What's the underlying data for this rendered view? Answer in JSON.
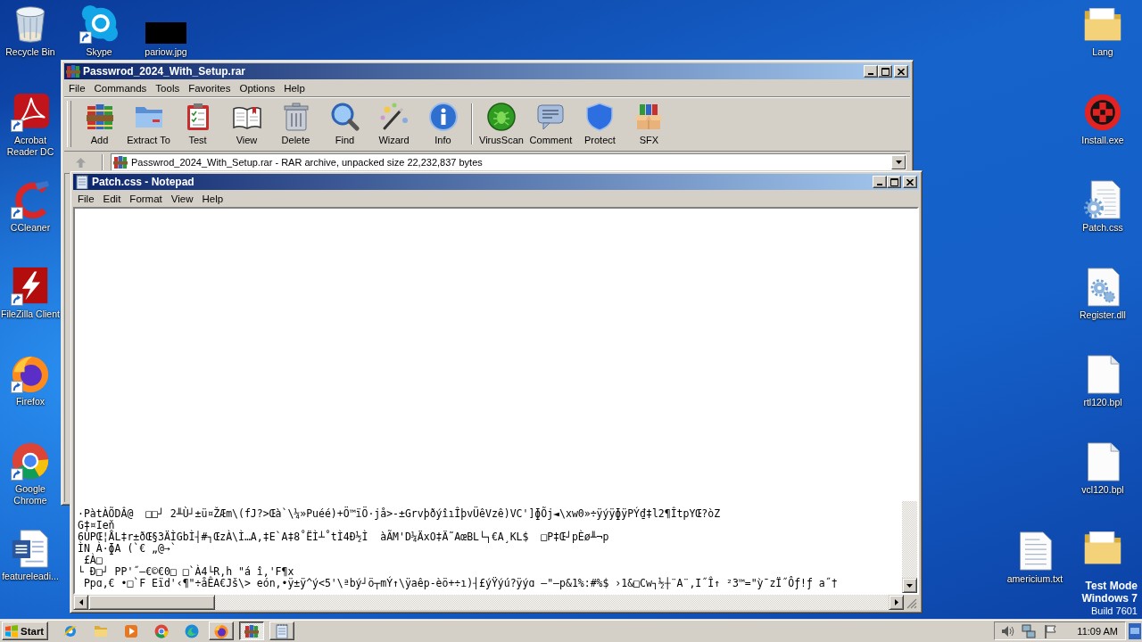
{
  "desktop": {
    "icons": [
      {
        "label": "Recycle Bin",
        "shortcut": false
      },
      {
        "label": "Skype",
        "shortcut": true
      },
      {
        "label": "pariow.jpg",
        "shortcut": false
      },
      {
        "label": "Acrobat Reader DC",
        "shortcut": true
      },
      {
        "label": "CCleaner",
        "shortcut": true
      },
      {
        "label": "FileZilla Client",
        "shortcut": true
      },
      {
        "label": "Firefox",
        "shortcut": true
      },
      {
        "label": "Google Chrome",
        "shortcut": true
      },
      {
        "label": "featureleadi...",
        "shortcut": false
      },
      {
        "label": "Lang",
        "shortcut": false
      },
      {
        "label": "Install.exe",
        "shortcut": false
      },
      {
        "label": "Patch.css",
        "shortcut": false
      },
      {
        "label": "Register.dll",
        "shortcut": false
      },
      {
        "label": "rtl120.bpl",
        "shortcut": false
      },
      {
        "label": "vcl120.bpl",
        "shortcut": false
      },
      {
        "label": "americium.txt",
        "shortcut": false
      },
      {
        "shortcut": false
      }
    ],
    "os_notice": [
      "Test Mode",
      "Windows 7",
      "Build 7601"
    ]
  },
  "archiver_window": {
    "title": "Passwrod_2024_With_Setup.rar",
    "menu": [
      "File",
      "Commands",
      "Tools",
      "Favorites",
      "Options",
      "Help"
    ],
    "toolbar": [
      [
        "Add",
        "Extract To",
        "Test",
        "View",
        "Delete",
        "Find",
        "Wizard",
        "Info"
      ],
      [
        "VirusScan",
        "Comment",
        "Protect",
        "SFX"
      ]
    ],
    "address": "Passwrod_2024_With_Setup.rar - RAR archive, unpacked size 22,232,837 bytes"
  },
  "notepad_window": {
    "title": "Patch.css - Notepad",
    "menu": [
      "File",
      "Edit",
      "Format",
      "View",
      "Help"
    ],
    "lines": [
      "·PàtÀÕDÂ@  □□┘ 2╨Ù┘±ü¤ŽÆm\\(fJ?>Œà`\\¼»Puéé)+Ö™ïÖ·jå>-±GrvþðýîıÎþvÜêVzê)VC']ɸÕj◄\\xw0»÷ÿýÿɸÿPÝ₫‡l2¶ÎtpYŒ?òZ",
      "G‡¤Ieň",
      "6ÙPŒ¦ÅL‡r±ðŒ§3ÄÌGbÌ┤#┐ŒzÀ\\Ì…A,‡E`A‡8˚ËÌ┴˚tÌ4Ð½Ì  àÃM'D¼ÄxO‡Ä˜AœBL└┐€A¸KL$  □P‡Œ┘pÈø╨¬p",
      "ÌN À·ɸA (`€ „@→`",
      " £À□",
      "└ Ð□┘ PP'˝–€©€0□ □`À4└R,h \"á î,'F¶x",
      " Ppɑ,€ •□`F Eïd'‹¶\"÷åÊA€Jš\\> eón,•ÿ±ÿ^ý<5'\\ªbý┘ö┬mÝ↑\\ÿaêp-èö+÷ı)┤£ýŸýú?ÿýɑ –\"–p&1%:#%$ ›1&□Cw┐½┼¨A¨,I˝Î↑ ²3™=\"ỳ¯zÏ˝Ôƒ!ƒ a˝†"
    ]
  },
  "taskbar": {
    "start": "Start",
    "tasks": [
      {
        "selected": false
      },
      {
        "selected": true
      },
      {
        "selected": false
      }
    ],
    "clock": "11:09 AM"
  }
}
